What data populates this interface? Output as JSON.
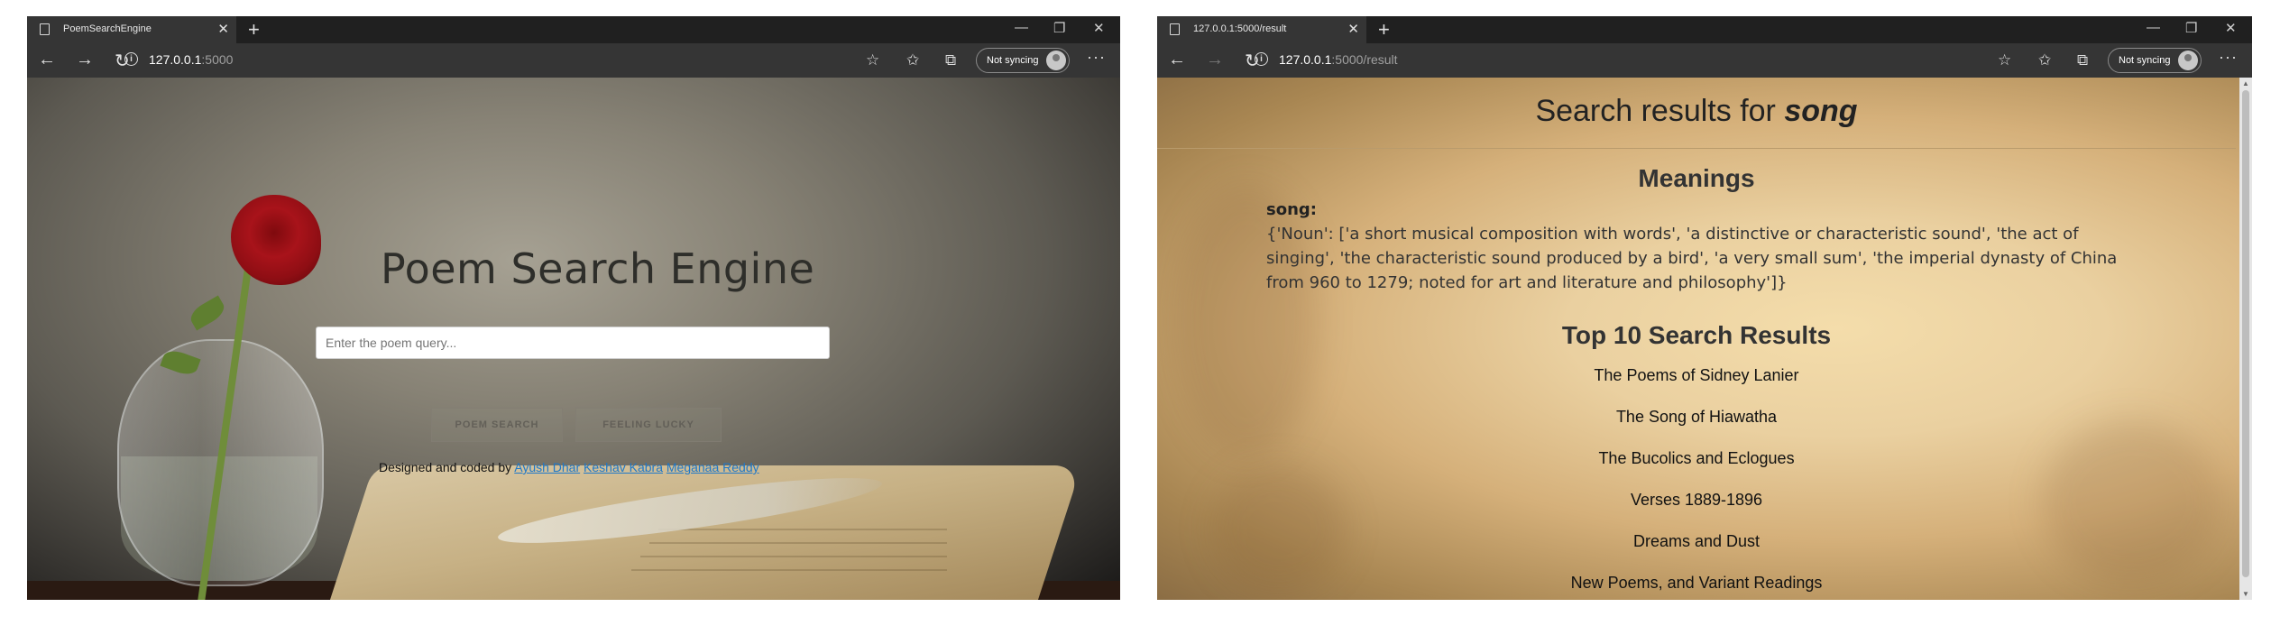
{
  "left_window": {
    "tab_title": "PoemSearchEngine",
    "url_host": "127.0.0.1",
    "url_rest": ":5000",
    "sync_label": "Not syncing",
    "page": {
      "title": "Poem Search Engine",
      "search_placeholder": "Enter the poem query...",
      "search_button": "POEM SEARCH",
      "lucky_button": "FEELING LUCKY",
      "credits_prefix": "Designed and coded by",
      "authors": [
        "Ayush Dhar",
        "Keshav Kabra",
        "Meganaa Reddy"
      ]
    }
  },
  "right_window": {
    "tab_title": "127.0.0.1:5000/result",
    "url_host": "127.0.0.1",
    "url_rest": ":5000/result",
    "sync_label": "Not syncing",
    "page": {
      "heading_prefix": "Search results for",
      "query": "song",
      "meanings_heading": "Meanings",
      "word_label": "song:",
      "definition": "{'Noun': ['a short musical composition with words', 'a distinctive or characteristic sound', 'the act of singing', 'the characteristic sound produced by a bird', 'a very small sum', 'the imperial dynasty of China from 960 to 1279; noted for art and literature and philosophy']}",
      "results_heading": "Top 10 Search Results",
      "results": [
        "The Poems of Sidney Lanier",
        "The Song of Hiawatha",
        "The Bucolics and Eclogues",
        "Verses 1889-1896",
        "Dreams and Dust",
        "New Poems, and Variant Readings"
      ]
    }
  },
  "icons": {
    "tab": "page-icon",
    "close": "close-icon",
    "new_tab": "plus-icon",
    "back": "back-arrow-icon",
    "forward": "forward-arrow-icon",
    "refresh": "refresh-icon",
    "info": "info-icon",
    "favorite": "star-icon",
    "favorites": "favorites-icon",
    "collections": "collections-icon",
    "more": "more-icon"
  }
}
